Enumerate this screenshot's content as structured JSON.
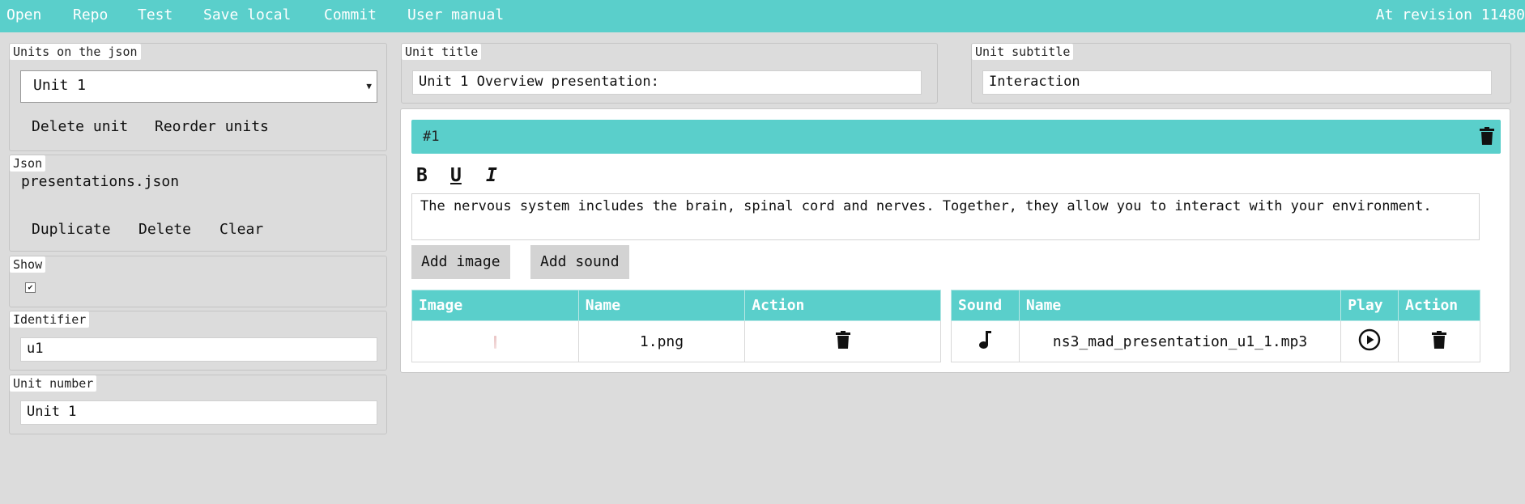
{
  "menu": {
    "items": [
      "Open",
      "Repo",
      "Test",
      "Save local",
      "Commit",
      "User manual"
    ],
    "revision_text": "At revision 11480"
  },
  "units_panel": {
    "legend": "Units on the json",
    "selected_unit": "Unit 1",
    "delete_label": "Delete unit",
    "reorder_label": "Reorder units"
  },
  "json_panel": {
    "legend": "Json",
    "filename": "presentations.json",
    "duplicate_label": "Duplicate",
    "delete_label": "Delete",
    "clear_label": "Clear"
  },
  "show_panel": {
    "legend": "Show",
    "checked": true,
    "check_glyph": "✔"
  },
  "identifier_panel": {
    "legend": "Identifier",
    "value": "u1"
  },
  "unit_number_panel": {
    "legend": "Unit number",
    "value": "Unit 1"
  },
  "unit_title": {
    "legend": "Unit title",
    "value": "Unit 1 Overview presentation:"
  },
  "unit_subtitle": {
    "legend": "Unit subtitle",
    "value": "Interaction"
  },
  "item": {
    "number": "#1",
    "format_buttons": {
      "bold": "B",
      "underline": "U",
      "italic": "I"
    },
    "text": "The nervous system includes the brain, spinal cord and nerves. Together, they allow you to interact with your environment.",
    "add_image_label": "Add image",
    "add_sound_label": "Add sound"
  },
  "image_table": {
    "headers": [
      "Image",
      "Name",
      "Action"
    ],
    "rows": [
      {
        "name": "1.png"
      }
    ]
  },
  "sound_table": {
    "headers": [
      "Sound",
      "Name",
      "Play",
      "Action"
    ],
    "rows": [
      {
        "name": "ns3_mad_presentation_u1_1.mp3"
      }
    ]
  },
  "colors": {
    "accent": "#5acfcb",
    "background": "#dcdcdc"
  },
  "icons": [
    "trash-icon",
    "music-note-icon",
    "play-circle-icon",
    "image-thumbnail"
  ]
}
